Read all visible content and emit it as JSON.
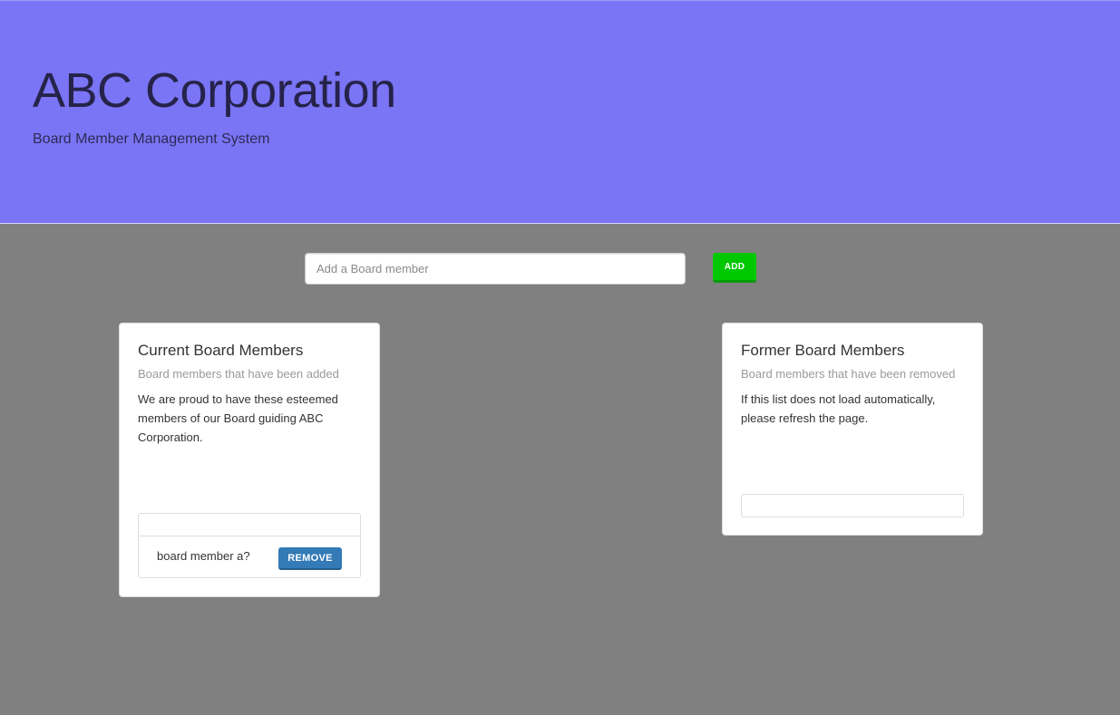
{
  "header": {
    "title": "ABC Corporation",
    "subtitle": "Board Member Management System"
  },
  "add_form": {
    "placeholder": "Add a Board member",
    "value": "",
    "button_label": "ADD"
  },
  "current_members": {
    "title": "Current Board Members",
    "subtitle": "Board members that have been added",
    "description": "We are proud to have these esteemed members of our Board guiding ABC Corporation.",
    "members": [
      {
        "name": "board member a?",
        "action_label": "REMOVE"
      }
    ]
  },
  "former_members": {
    "title": "Former Board Members",
    "subtitle": "Board members that have been removed",
    "description": "If this list does not load automatically, please refresh the page.",
    "members": []
  },
  "colors": {
    "header_bg": "#7a75f5",
    "page_bg": "#808080",
    "add_button": "#00c800",
    "remove_button": "#337ab7"
  }
}
